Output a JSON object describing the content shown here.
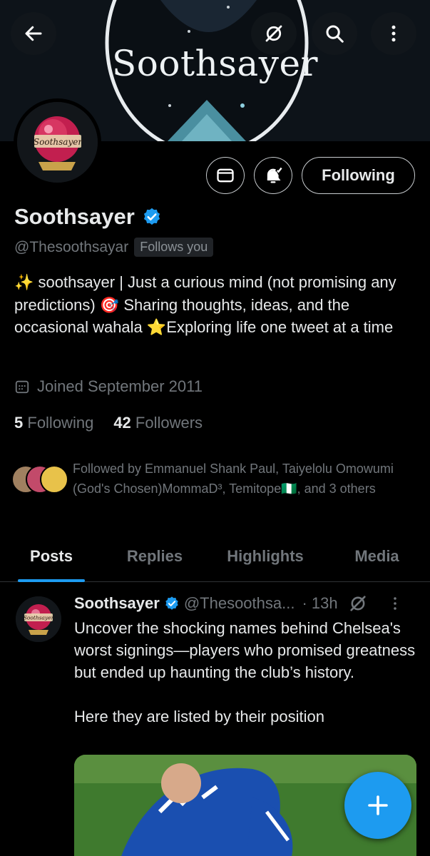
{
  "banner": {
    "logo_text": "Soothsayer"
  },
  "avatar": {
    "label": "Soothsayer"
  },
  "actions": {
    "following_label": "Following"
  },
  "profile": {
    "name": "Soothsayer",
    "handle": "@Thesoothsayar",
    "follows_you": "Follows you",
    "bio": "✨ soothsayer | Just a curious mind (not promising any predictions) 🎯 Sharing thoughts, ideas, and the occasional wahala ⭐Exploring life one tweet at a time",
    "joined": "Joined September 2011",
    "following_count": "5",
    "following_label": "Following",
    "followers_count": "42",
    "followers_label": "Followers",
    "followed_by": "Followed by Emmanuel Shank Paul, Taiyelolu Omowumi (God's Chosen)MommaD³, Temitope🇳🇬, and 3 others"
  },
  "tabs": [
    {
      "label": "Posts"
    },
    {
      "label": "Replies"
    },
    {
      "label": "Highlights"
    },
    {
      "label": "Media"
    }
  ],
  "tweet": {
    "avatar_label": "Soothsayer",
    "name": "Soothsayer",
    "handle": "@Thesoothsa...",
    "time": "· 13h",
    "text": "Uncover the shocking names behind Chelsea's worst signings—players who promised greatness but ended up haunting the club’s history.\n\nHere they are listed by their position"
  },
  "colors": {
    "accent": "#1d9bf0",
    "background": "#000000",
    "muted": "#71767b"
  }
}
